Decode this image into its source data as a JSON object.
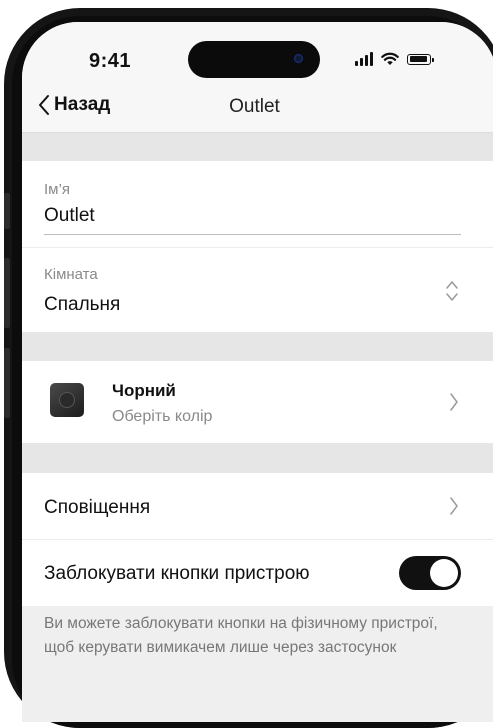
{
  "status_bar": {
    "time": "9:41"
  },
  "nav": {
    "back_label": "Назад",
    "title": "Outlet"
  },
  "name_field": {
    "label": "Ім’я",
    "value": "Outlet"
  },
  "room_field": {
    "label": "Кімната",
    "value": "Спальня"
  },
  "color_row": {
    "title": "Чорний",
    "subtitle": "Оберіть колір",
    "swatch_color": "#2a2a2a"
  },
  "notifications_row": {
    "label": "Сповіщення"
  },
  "lock_buttons_row": {
    "label": "Заблокувати кнопки пристрою",
    "toggle_on": true
  },
  "hint": {
    "text": "Ви можете заблокувати кнопки на фізичному пристрої, щоб керувати вимикачем лише через застосунок"
  },
  "colors": {
    "background": "#efefef",
    "section_gap": "#e6e6e6",
    "toggle_on": "#111111"
  }
}
